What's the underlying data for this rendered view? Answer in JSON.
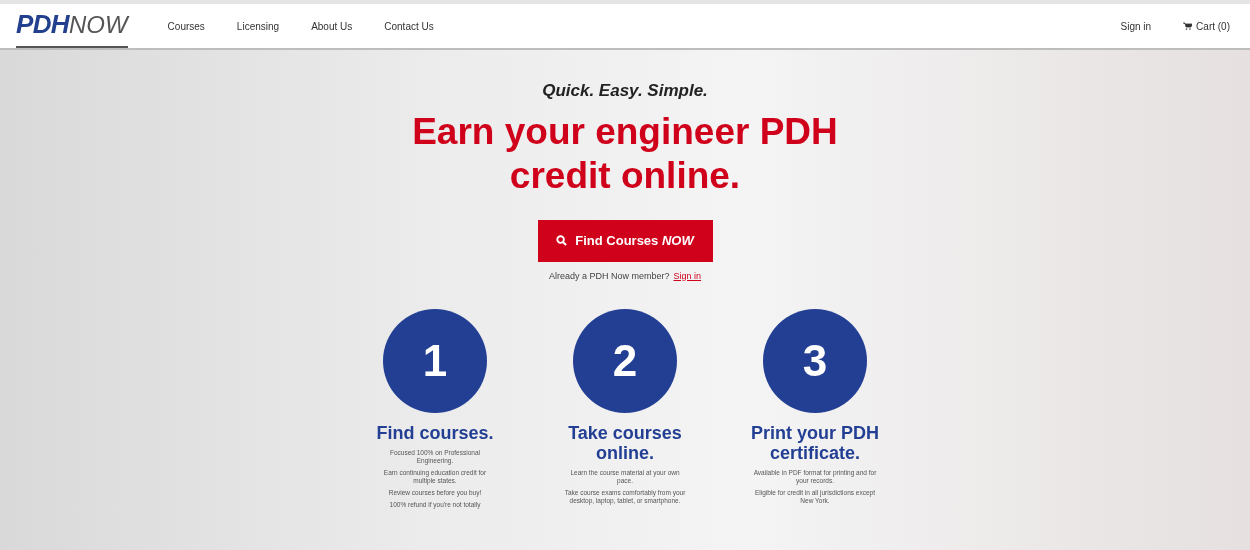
{
  "nav": {
    "logo_bold": "PDH",
    "logo_light": "NOW",
    "links": [
      "Courses",
      "Licensing",
      "About Us",
      "Contact Us"
    ],
    "sign_in": "Sign in",
    "cart": "Cart (0)"
  },
  "hero": {
    "tagline": "Quick. Easy. Simple.",
    "headline": "Earn your engineer PDH credit online.",
    "button": "Find Courses *NOW*",
    "member_prompt": "Already a PDH Now member?",
    "member_link": "Sign in"
  },
  "steps": [
    {
      "number": "1",
      "title": "Find courses.",
      "lines": [
        "Focused 100% on Professional Engineering.",
        "Earn continuing education credit for multiple states.",
        "Review courses before you buy!",
        "100% refund if you're not totally"
      ]
    },
    {
      "number": "2",
      "title": "Take courses online.",
      "lines": [
        "Learn the course material at your own pace.",
        "Take course exams comfortably from your desktop, laptop, tablet, or smartphone."
      ]
    },
    {
      "number": "3",
      "title": "Print your PDH certificate.",
      "lines": [
        "Available in PDF format for printing and for your records.",
        "Eligible for credit in all jurisdictions except New York."
      ]
    }
  ]
}
